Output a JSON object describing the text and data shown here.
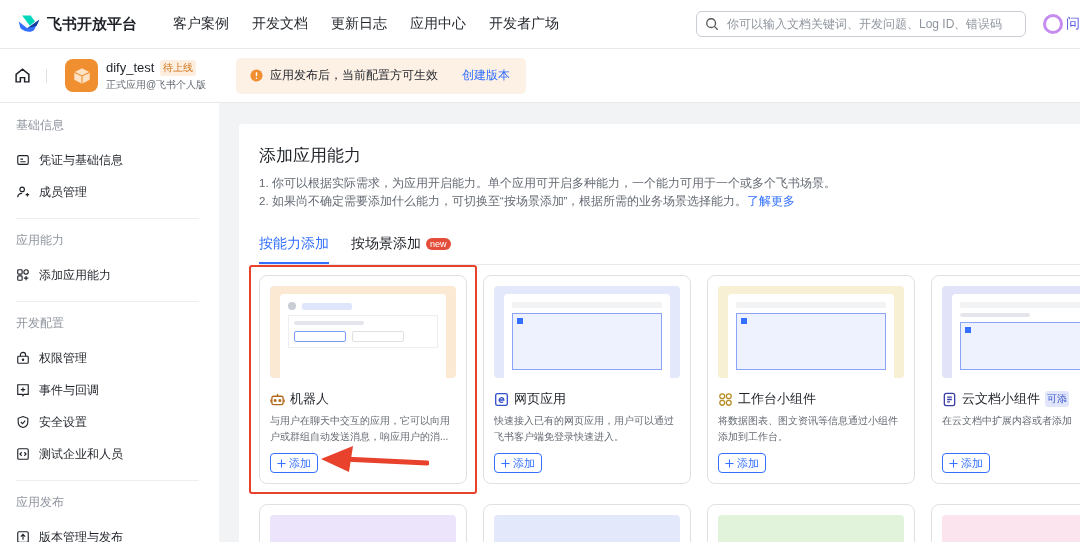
{
  "header": {
    "brand": "飞书开放平台",
    "nav": [
      "客户案例",
      "开发文档",
      "更新日志",
      "应用中心",
      "开发者广场"
    ],
    "search": {
      "placeholder": "你可以输入文档关键词、开发问题、Log ID、错误码"
    },
    "assistant_label": "问"
  },
  "app_bar": {
    "app_name": "dify_test",
    "status_badge": "待上线",
    "app_subtitle": "正式应用@飞书个人版",
    "notice": {
      "text": "应用发布后，当前配置方可生效",
      "link": "创建版本"
    }
  },
  "sidebar": {
    "groups": [
      {
        "title": "基础信息",
        "items": [
          {
            "label": "凭证与基础信息",
            "kind": "card"
          },
          {
            "label": "成员管理",
            "kind": "members"
          }
        ]
      },
      {
        "title": "应用能力",
        "items": [
          {
            "label": "添加应用能力",
            "kind": "apps"
          }
        ]
      },
      {
        "title": "开发配置",
        "items": [
          {
            "label": "权限管理",
            "kind": "lock"
          },
          {
            "label": "事件与回调",
            "kind": "event"
          },
          {
            "label": "安全设置",
            "kind": "shield"
          },
          {
            "label": "测试企业和人员",
            "kind": "code"
          }
        ]
      },
      {
        "title": "应用发布",
        "items": [
          {
            "label": "版本管理与发布",
            "kind": "upload"
          }
        ]
      }
    ]
  },
  "main": {
    "title": "添加应用能力",
    "notes": [
      "1. 你可以根据实际需求，为应用开启能力。单个应用可开启多种能力，一个能力可用于一个或多个飞书场景。",
      "2. 如果尚不确定需要添加什么能力，可切换至“按场景添加”，根据所需的业务场景选择能力。"
    ],
    "learn_more": "了解更多",
    "tabs": [
      {
        "label": "按能力添加",
        "selected": true
      },
      {
        "label": "按场景添加",
        "selected": false,
        "badge": "new"
      }
    ],
    "cards": [
      {
        "kind": "robot",
        "title": "机器人",
        "description": "与用户在聊天中交互的应用，它可以向用户或群组自动发送消息，响应用户的消...",
        "button": "添加",
        "highlighted": true,
        "color": "#fbe9d4"
      },
      {
        "kind": "web",
        "title": "网页应用",
        "description": "快速接入已有的网页应用，用户可以通过飞书客户端免登录快速进入。",
        "button": "添加",
        "highlighted": false,
        "color": "#e3e9fb"
      },
      {
        "kind": "widget",
        "title": "工作台小组件",
        "description": "将数据图表、图文资讯等信息通过小组件添加到工作台。",
        "button": "添加",
        "highlighted": false,
        "color": "#f8f0d4"
      },
      {
        "kind": "doc",
        "title": "云文档小组件",
        "badge": "可添",
        "description": "在云文档中扩展内容或者添加",
        "button": "添加",
        "highlighted": false,
        "color": "#e2e3f8"
      }
    ],
    "more_cards": [
      {
        "color": "#ece4fa"
      },
      {
        "color": "#e3e9fb"
      },
      {
        "color": "#e2f3dc"
      },
      {
        "color": "#fbe4ee"
      }
    ]
  }
}
